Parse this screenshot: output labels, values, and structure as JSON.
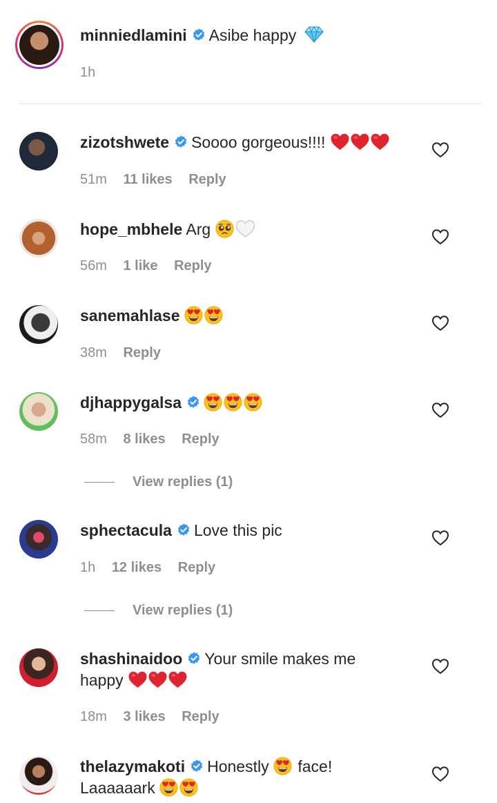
{
  "caption": {
    "username": "minniedlamini",
    "text": "Asibe happy",
    "time": "1h",
    "emoji_icon": "gem-icon"
  },
  "comments": [
    {
      "username": "zizotshwete",
      "text": "Soooo gorgeous!!!!",
      "time": "51m",
      "likes": "11 likes",
      "reply": "Reply"
    },
    {
      "username": "hope_mbhele",
      "text": "Arg",
      "time": "56m",
      "likes": "1 like",
      "reply": "Reply"
    },
    {
      "username": "sanemahlase",
      "text": "",
      "time": "38m",
      "likes": "",
      "reply": "Reply"
    },
    {
      "username": "djhappygalsa",
      "text": "",
      "time": "58m",
      "likes": "8 likes",
      "reply": "Reply",
      "view_replies": "View replies (1)"
    },
    {
      "username": "sphectacula",
      "text": "Love this pic",
      "time": "1h",
      "likes": "12 likes",
      "reply": "Reply",
      "view_replies": "View replies (1)"
    },
    {
      "username": "shashinaidoo",
      "text": "Your smile makes me",
      "text2": "happy",
      "time": "18m",
      "likes": "3 likes",
      "reply": "Reply"
    },
    {
      "username": "thelazymakoti",
      "text": "Honestly",
      "text_b": "face!",
      "text2": "Laaaaaark"
    }
  ],
  "colors": {
    "verified_blue": "#3897f0",
    "meta_gray": "#8e8e8e",
    "heart_red": "#e0242f"
  }
}
